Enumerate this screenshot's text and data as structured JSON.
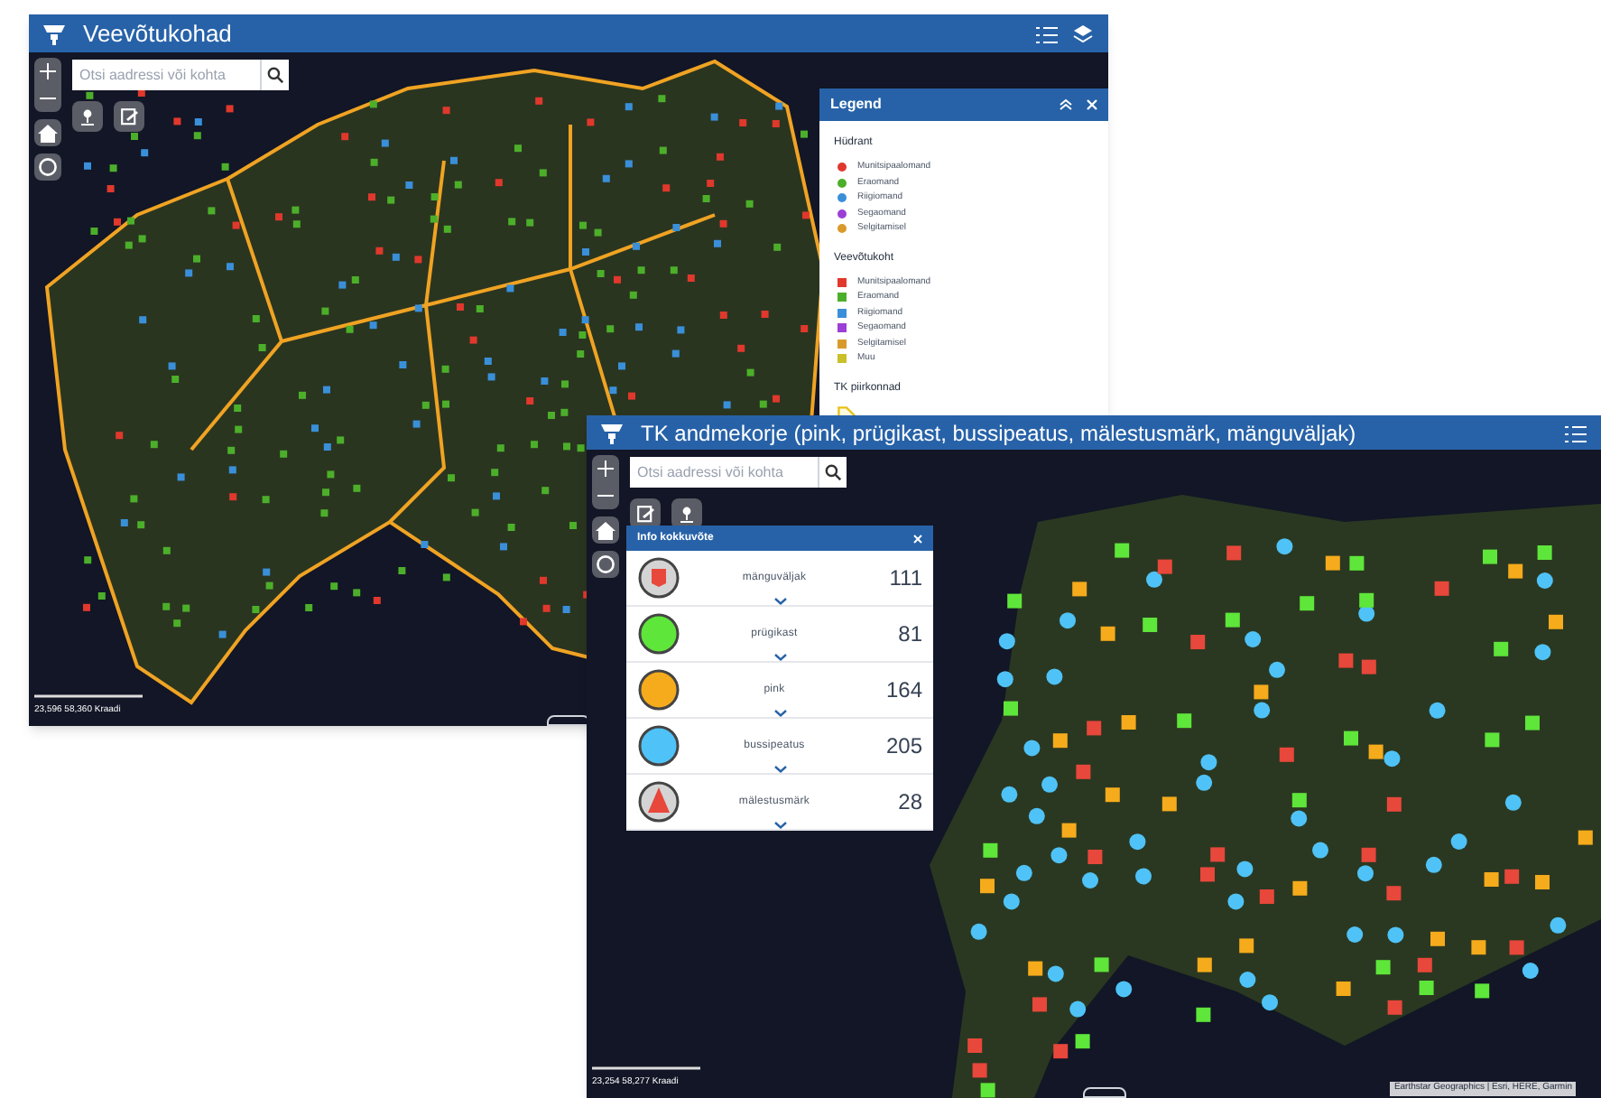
{
  "windows": [
    {
      "title": "Veevõtukohad",
      "search": {
        "placeholder": "Otsi aadressi või kohta"
      },
      "coordinates": "23,596 58,360 Kraadi",
      "legend": {
        "title": "Legend",
        "groups": [
          {
            "title": "Hüdrant",
            "kind": "dot",
            "items": [
              {
                "label": "Munitsipaalomand",
                "color": "#e0382c"
              },
              {
                "label": "Eraomand",
                "color": "#4caf2a"
              },
              {
                "label": "Riigiomand",
                "color": "#3a8fd9"
              },
              {
                "label": "Segaomand",
                "color": "#9b3fd6"
              },
              {
                "label": "Selgitamisel",
                "color": "#d99a2b"
              }
            ]
          },
          {
            "title": "Veevõtukoht",
            "kind": "square",
            "items": [
              {
                "label": "Munitsipaalomand",
                "color": "#e0382c"
              },
              {
                "label": "Eraomand",
                "color": "#4caf2a"
              },
              {
                "label": "Riigiomand",
                "color": "#3a8fd9"
              },
              {
                "label": "Segaomand",
                "color": "#9b3fd6"
              },
              {
                "label": "Selgitamisel",
                "color": "#d99a2b"
              },
              {
                "label": "Muu",
                "color": "#c9c02a"
              }
            ]
          },
          {
            "title": "TK piirkonnad",
            "kind": "polygon"
          }
        ]
      }
    },
    {
      "title": "TK andmekorje (pink, prügikast, bussipeatus, mälestusmärk, mänguväljak)",
      "search": {
        "placeholder": "Otsi aadressi või kohta"
      },
      "coordinates": "23,254 58,277 Kraadi",
      "attribution": "Earthstar Geographics | Esri, HERE, Garmin",
      "info": {
        "title": "Info kokkuvõte",
        "items": [
          {
            "label": "mänguväljak",
            "count": "111",
            "kind": "square",
            "color": "#e8473b"
          },
          {
            "label": "prügikast",
            "count": "81",
            "kind": "fill",
            "color": "#5ee63a"
          },
          {
            "label": "pink",
            "count": "164",
            "kind": "fill",
            "color": "#f5ab1b"
          },
          {
            "label": "bussipeatus",
            "count": "205",
            "kind": "fill",
            "color": "#4fc3f7"
          },
          {
            "label": "mälestusmärk",
            "count": "28",
            "kind": "triangle",
            "color": "#e8473b"
          }
        ]
      }
    }
  ]
}
